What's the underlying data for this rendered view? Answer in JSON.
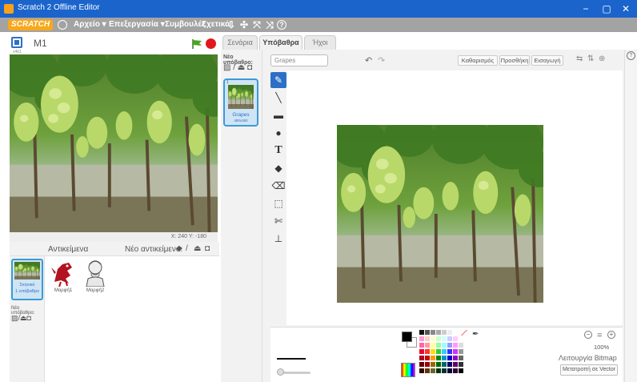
{
  "window": {
    "title": "Scratch 2 Offline Editor",
    "minimize": "−",
    "restore": "▢",
    "close": "✕"
  },
  "menubar": {
    "logo": "SCRATCH",
    "items": [
      "Αρχείο ▾",
      "Επεξεργασία ▾",
      "Συμβουλές",
      "Σχετικά"
    ],
    "tools": {
      "duplicate": "⇩",
      "delete": "✣",
      "grow": "⤧",
      "shrink": "⤨",
      "help": "?"
    }
  },
  "stage": {
    "version": "v461",
    "sprite_name": "Μ1",
    "coords_text": "Χ: 240  Υ: -180"
  },
  "sprites": {
    "title": "Αντικείμενα",
    "new_sprite_label": "Νέο αντικείμενο:",
    "stage_label_1": "Σκηνικό",
    "stage_label_2": "1 υπόβαθρο",
    "new_backdrop_label": "Νέο υπόβαθρο:",
    "items": [
      "Μορφή1",
      "Μορφή2"
    ]
  },
  "tabs": [
    "Σενάρια",
    "Υπόβαθρα",
    "Ήχοι"
  ],
  "backdrops_panel": {
    "new_backdrop_title": "Νέο υπόβαθρο:",
    "backdrop": {
      "number": "1",
      "name": "Grapes",
      "size": "480x360"
    }
  },
  "editor": {
    "name_value": "Grapes",
    "undo": "↶",
    "redo": "↷",
    "clear_label": "Καθαρισμός",
    "add_label": "Προσθήκη",
    "import_label": "Εισαγωγή",
    "tools": [
      "✎",
      "╲",
      "▬",
      "●",
      "T",
      "◆",
      "⌫",
      "⬚",
      "✄",
      "⊥"
    ],
    "zoom_level": "100%",
    "zoom_out": "−",
    "zoom_reset": "=",
    "zoom_in": "+",
    "mode_label": "Λειτουργία Bitmap",
    "convert_label": "Μετατροπή σε Vector"
  },
  "colors": {
    "titlebar": "#1b64cc",
    "menubar": "#a3a3a3",
    "accent": "#2d6fc6",
    "logo": "#f8a81c",
    "stop": "#e0191f"
  }
}
